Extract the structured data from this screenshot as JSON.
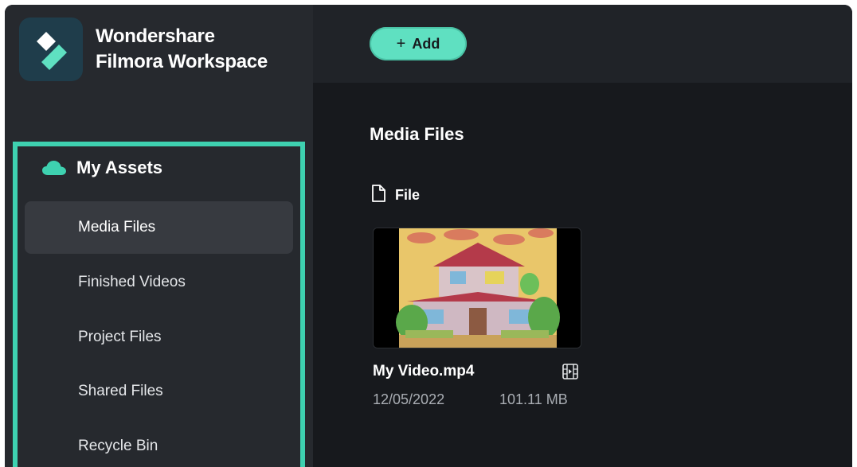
{
  "app": {
    "brand_line1": "Wondershare",
    "brand_line2": "Filmora Workspace",
    "logo_icon": "filmora-logo-icon"
  },
  "colors": {
    "accent": "#3ed1b0",
    "add_button": "#5fe0c1",
    "sidebar_bg": "#26292e",
    "main_bg": "#17191d",
    "active_item_bg": "#373a40"
  },
  "toolbar": {
    "add_icon": "+",
    "add_label": "Add"
  },
  "sidebar": {
    "section_icon": "cloud-icon",
    "section_title": "My Assets",
    "active_item": "Media Files",
    "items": [
      {
        "label": "Media Files"
      },
      {
        "label": "Finished Videos"
      },
      {
        "label": "Project Files"
      },
      {
        "label": "Shared Files"
      },
      {
        "label": "Recycle Bin"
      }
    ]
  },
  "main": {
    "title": "Media Files",
    "file_group_icon": "document-icon",
    "file_group_label": "File",
    "files": [
      {
        "name": "My Video.mp4",
        "type_icon": "film-icon",
        "date": "12/05/2022",
        "size": "101.11 MB"
      }
    ]
  }
}
